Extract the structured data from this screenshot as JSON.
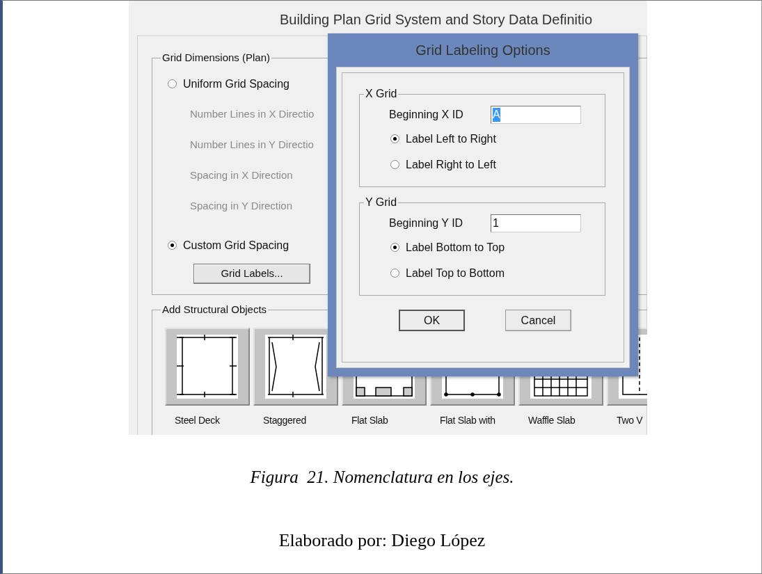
{
  "background_window": {
    "title": "Building Plan Grid System and Story Data Definitio",
    "grid_dimensions": {
      "title": "Grid Dimensions (Plan)",
      "items": [
        {
          "kind": "radio",
          "label": "Uniform Grid Spacing",
          "selected": false
        },
        {
          "kind": "label",
          "label": "Number Lines in X Directio"
        },
        {
          "kind": "label",
          "label": "Number Lines in Y Directio"
        },
        {
          "kind": "label",
          "label": "Spacing in X Direction"
        },
        {
          "kind": "label",
          "label": "Spacing in Y Direction"
        },
        {
          "kind": "radio",
          "label": "Custom Grid Spacing",
          "selected": true
        },
        {
          "kind": "button",
          "label": "Grid Labels..."
        }
      ]
    },
    "structural_objects": {
      "title": "Add Structural Objects",
      "items": [
        {
          "kind": "steel_deck",
          "label": "Steel Deck"
        },
        {
          "kind": "staggered",
          "label": "Staggered"
        },
        {
          "kind": "flat_slab",
          "label": "Flat Slab"
        },
        {
          "kind": "flat_slab_beams",
          "label": "Flat Slab with"
        },
        {
          "kind": "waffle",
          "label": "Waffle Slab"
        },
        {
          "kind": "two_way",
          "label": "Two V"
        }
      ]
    }
  },
  "dialog": {
    "title": "Grid Labeling Options",
    "groups": [
      {
        "title": "X Grid",
        "field_label": "Beginning X ID",
        "value": "A",
        "value_highlighted": true,
        "options": [
          {
            "label": "Label Left to Right",
            "selected": true
          },
          {
            "label": "Label Right to Left",
            "selected": false
          }
        ]
      },
      {
        "title": "Y Grid",
        "field_label": "Beginning Y ID",
        "value": "1",
        "value_highlighted": false,
        "options": [
          {
            "label": "Label Bottom to Top",
            "selected": true
          },
          {
            "label": "Label Top to Bottom",
            "selected": false
          }
        ]
      }
    ],
    "buttons": [
      {
        "label": "OK",
        "default": true
      },
      {
        "label": "Cancel",
        "default": false
      }
    ]
  },
  "caption": "Figura  21. Nomenclatura en los ejes.",
  "credit": "Elaborado por: Diego López"
}
